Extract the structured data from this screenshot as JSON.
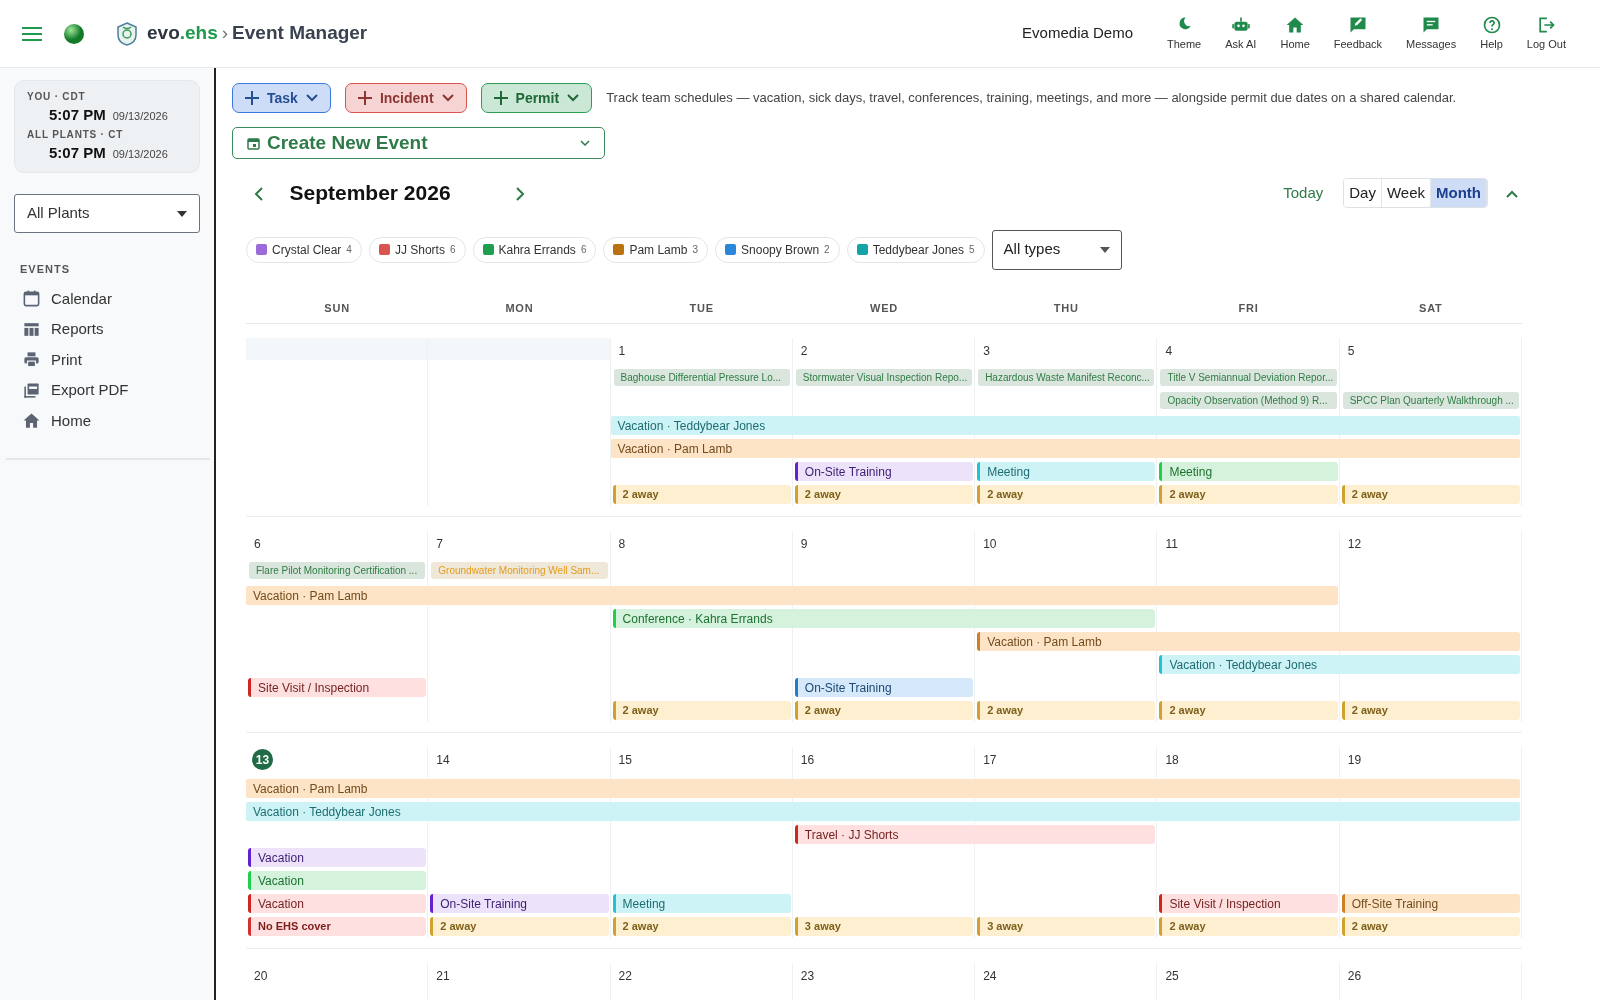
{
  "topbar": {
    "brand": {
      "name": "evo",
      "suffix": ".ehs"
    },
    "separator": "›",
    "app_title": "Event Manager",
    "account": "Evomedia Demo",
    "actions": [
      {
        "label": "Theme",
        "kind": "moon"
      },
      {
        "label": "Ask AI",
        "kind": "robot"
      },
      {
        "label": "Home",
        "kind": "house"
      },
      {
        "label": "Feedback",
        "kind": "feedback"
      },
      {
        "label": "Messages",
        "kind": "messages"
      },
      {
        "label": "Help",
        "kind": "help"
      },
      {
        "label": "Log Out",
        "kind": "logout"
      }
    ]
  },
  "sidebar": {
    "clocks": [
      {
        "label": "YOU · CDT",
        "time": "5:07 PM",
        "date": "09/13/2026"
      },
      {
        "label": "ALL PLANTS · CT",
        "time": "5:07 PM",
        "date": "09/13/2026"
      }
    ],
    "plant_select": "All Plants",
    "section": "EVENTS",
    "items": [
      {
        "label": "Calendar",
        "kind": "calendar"
      },
      {
        "label": "Reports",
        "kind": "table"
      },
      {
        "label": "Print",
        "kind": "printer"
      },
      {
        "label": "Export PDF",
        "kind": "pdf"
      },
      {
        "label": "Home",
        "kind": "house"
      }
    ]
  },
  "toolbar": {
    "buttons": [
      {
        "label": "Task",
        "color": "#3b78e0"
      },
      {
        "label": "Incident",
        "color": "#d9534f"
      },
      {
        "label": "Permit",
        "color": "#2f9e55"
      }
    ],
    "description": "Track team schedules — vacation, sick days, travel, conferences, training, meetings, and more — alongside permit due dates on a shared calendar.",
    "create_event": "Create New Event"
  },
  "calendar": {
    "month": "September 2026",
    "today_button": "Today",
    "views": [
      {
        "label": "Day",
        "selected": false
      },
      {
        "label": "Week",
        "selected": false
      },
      {
        "label": "Month",
        "selected": true
      }
    ],
    "filters": [
      {
        "name": "Crystal Clear",
        "count": "4",
        "color": "#9b6bdc"
      },
      {
        "name": "JJ Shorts",
        "count": "6",
        "color": "#d9534f"
      },
      {
        "name": "Kahra Errands",
        "count": "6",
        "color": "#1e9e4f"
      },
      {
        "name": "Pam Lamb",
        "count": "3",
        "color": "#b8720f"
      },
      {
        "name": "Snoopy Brown",
        "count": "2",
        "color": "#2a86d8"
      },
      {
        "name": "Teddybear Jones",
        "count": "5",
        "color": "#14a3a8"
      }
    ],
    "type_select": "All types",
    "weekdays": [
      "SUN",
      "MON",
      "TUE",
      "WED",
      "THU",
      "FRI",
      "SAT"
    ],
    "weeks": [
      {
        "days": [
          {
            "outside": true
          },
          {
            "outside": true
          },
          {
            "label": "1",
            "today": false
          },
          {
            "label": "2",
            "today": false
          },
          {
            "label": "3",
            "today": false
          },
          {
            "label": "4",
            "today": false
          },
          {
            "label": "5",
            "today": false
          }
        ],
        "lanes": [
          [
            {
              "kind": "empty"
            },
            {
              "kind": "empty"
            },
            {
              "kind": "permit",
              "text": "Baghouse Differential Pressure Lo...",
              "color": "#2f7d45"
            },
            {
              "kind": "permit",
              "text": "Stormwater Visual Inspection Repo...",
              "color": "#2f7d45"
            },
            {
              "kind": "permit",
              "text": "Hazardous Waste Manifest Reconc...",
              "color": "#2f7d45"
            },
            {
              "kind": "permit",
              "text": "Title V Semiannual Deviation Repor...",
              "color": "#2f7d45"
            },
            {
              "kind": "empty"
            }
          ],
          [
            {
              "kind": "empty"
            },
            {
              "kind": "empty"
            },
            {
              "kind": "empty"
            },
            {
              "kind": "empty"
            },
            {
              "kind": "empty"
            },
            {
              "kind": "permit",
              "text": "Opacity Observation (Method 9) R...",
              "color": "#2f7d45"
            },
            {
              "kind": "permit",
              "text": "SPCC Plan Quarterly Walkthrough ...",
              "color": "#2f7d45"
            }
          ],
          [
            {
              "kind": "empty"
            },
            {
              "kind": "empty"
            },
            {
              "kind": "bar",
              "text": "Vacation · Teddybear Jones",
              "color": "#cdf3f6",
              "starts": false
            },
            {
              "kind": "continued"
            },
            {
              "kind": "continued"
            },
            {
              "kind": "continued"
            },
            {
              "kind": "continued"
            }
          ],
          [
            {
              "kind": "empty"
            },
            {
              "kind": "empty"
            },
            {
              "kind": "bar",
              "text": "Vacation · Pam Lamb",
              "color": "#fde4c6",
              "starts": false
            },
            {
              "kind": "continued"
            },
            {
              "kind": "continued"
            },
            {
              "kind": "continued"
            },
            {
              "kind": "continued"
            }
          ],
          [
            {
              "kind": "empty"
            },
            {
              "kind": "empty"
            },
            {
              "kind": "empty"
            },
            {
              "kind": "bar",
              "text": "On-Site Training",
              "color": "#ece3fb",
              "starts": true
            },
            {
              "kind": "bar",
              "text": "Meeting",
              "color": "#cdf3f6",
              "starts": true
            },
            {
              "kind": "bar",
              "text": "Meeting",
              "color": "#d5f2dc",
              "starts": true
            },
            {
              "kind": "empty"
            }
          ],
          [
            {
              "kind": "empty"
            },
            {
              "kind": "empty"
            },
            {
              "kind": "away",
              "text": "2 away",
              "color": "#fdefcf"
            },
            {
              "kind": "away",
              "text": "2 away",
              "color": "#fdefcf"
            },
            {
              "kind": "away",
              "text": "2 away",
              "color": "#fdefcf"
            },
            {
              "kind": "away",
              "text": "2 away",
              "color": "#fdefcf"
            },
            {
              "kind": "away",
              "text": "2 away",
              "color": "#fdefcf"
            }
          ]
        ]
      },
      {
        "days": [
          {
            "label": "6",
            "today": false
          },
          {
            "label": "7",
            "today": false
          },
          {
            "label": "8",
            "today": false
          },
          {
            "label": "9",
            "today": false
          },
          {
            "label": "10",
            "today": false
          },
          {
            "label": "11",
            "today": false
          },
          {
            "label": "12",
            "today": false
          }
        ],
        "lanes": [
          [
            {
              "kind": "permit",
              "text": "Flare Pilot Monitoring Certification ...",
              "color": "#2f7d45"
            },
            {
              "kind": "permit",
              "text": "Groundwater Monitoring Well Sam...",
              "color": "#e39b1c"
            },
            {
              "kind": "empty"
            },
            {
              "kind": "empty"
            },
            {
              "kind": "empty"
            },
            {
              "kind": "empty"
            },
            {
              "kind": "empty"
            }
          ],
          [
            {
              "kind": "bar",
              "text": "Vacation · Pam Lamb",
              "color": "#fde4c6",
              "starts": false
            },
            {
              "kind": "continued"
            },
            {
              "kind": "continued"
            },
            {
              "kind": "continued"
            },
            {
              "kind": "continued"
            },
            {
              "kind": "continued"
            },
            {
              "kind": "empty"
            }
          ],
          [
            {
              "kind": "empty"
            },
            {
              "kind": "empty"
            },
            {
              "kind": "bar",
              "text": "Conference · Kahra Errands",
              "color": "#d5f2dc",
              "starts": true
            },
            {
              "kind": "continued"
            },
            {
              "kind": "continued"
            },
            {
              "kind": "empty"
            },
            {
              "kind": "empty"
            }
          ],
          [
            {
              "kind": "empty"
            },
            {
              "kind": "empty"
            },
            {
              "kind": "empty"
            },
            {
              "kind": "empty"
            },
            {
              "kind": "bar",
              "text": "Vacation · Pam Lamb",
              "color": "#fde4c6",
              "starts": true
            },
            {
              "kind": "continued"
            },
            {
              "kind": "continued"
            }
          ],
          [
            {
              "kind": "empty"
            },
            {
              "kind": "empty"
            },
            {
              "kind": "empty"
            },
            {
              "kind": "empty"
            },
            {
              "kind": "empty"
            },
            {
              "kind": "bar",
              "text": "Vacation · Teddybear Jones",
              "color": "#cdf3f6",
              "starts": true
            },
            {
              "kind": "continued"
            }
          ],
          [
            {
              "kind": "bar",
              "text": "Site Visit / Inspection",
              "color": "#fde0df",
              "starts": true
            },
            {
              "kind": "empty"
            },
            {
              "kind": "empty"
            },
            {
              "kind": "bar",
              "text": "On-Site Training",
              "color": "#d6e9fb",
              "starts": true
            },
            {
              "kind": "empty"
            },
            {
              "kind": "empty"
            },
            {
              "kind": "empty"
            }
          ],
          [
            {
              "kind": "empty"
            },
            {
              "kind": "empty"
            },
            {
              "kind": "away",
              "text": "2 away",
              "color": "#fdefcf"
            },
            {
              "kind": "away",
              "text": "2 away",
              "color": "#fdefcf"
            },
            {
              "kind": "away",
              "text": "2 away",
              "color": "#fdefcf"
            },
            {
              "kind": "away",
              "text": "2 away",
              "color": "#fdefcf"
            },
            {
              "kind": "away",
              "text": "2 away",
              "color": "#fdefcf"
            }
          ]
        ]
      },
      {
        "days": [
          {
            "label": "13",
            "today": true
          },
          {
            "label": "14",
            "today": false
          },
          {
            "label": "15",
            "today": false
          },
          {
            "label": "16",
            "today": false
          },
          {
            "label": "17",
            "today": false
          },
          {
            "label": "18",
            "today": false
          },
          {
            "label": "19",
            "today": false
          }
        ],
        "lanes": [
          [
            {
              "kind": "bar",
              "text": "Vacation · Pam Lamb",
              "color": "#fde4c6",
              "starts": false
            },
            {
              "kind": "continued"
            },
            {
              "kind": "continued"
            },
            {
              "kind": "continued"
            },
            {
              "kind": "continued"
            },
            {
              "kind": "continued"
            },
            {
              "kind": "continued"
            }
          ],
          [
            {
              "kind": "bar",
              "text": "Vacation · Teddybear Jones",
              "color": "#cdf3f6",
              "starts": false
            },
            {
              "kind": "continued"
            },
            {
              "kind": "continued"
            },
            {
              "kind": "continued"
            },
            {
              "kind": "continued"
            },
            {
              "kind": "continued"
            },
            {
              "kind": "continued"
            }
          ],
          [
            {
              "kind": "empty"
            },
            {
              "kind": "empty"
            },
            {
              "kind": "empty"
            },
            {
              "kind": "bar",
              "text": "Travel · JJ Shorts",
              "color": "#fde0df",
              "starts": true
            },
            {
              "kind": "continued"
            },
            {
              "kind": "empty"
            },
            {
              "kind": "empty"
            }
          ],
          [
            {
              "kind": "bar",
              "text": "Vacation",
              "color": "#ece3fb",
              "starts": true
            },
            {
              "kind": "empty"
            },
            {
              "kind": "empty"
            },
            {
              "kind": "empty"
            },
            {
              "kind": "empty"
            },
            {
              "kind": "empty"
            },
            {
              "kind": "empty"
            }
          ],
          [
            {
              "kind": "bar",
              "text": "Vacation",
              "color": "#d5f2dc",
              "starts": true
            },
            {
              "kind": "empty"
            },
            {
              "kind": "empty"
            },
            {
              "kind": "empty"
            },
            {
              "kind": "empty"
            },
            {
              "kind": "empty"
            },
            {
              "kind": "empty"
            }
          ],
          [
            {
              "kind": "bar",
              "text": "Vacation",
              "color": "#fde0df",
              "starts": true
            },
            {
              "kind": "bar",
              "text": "On-Site Training",
              "color": "#ece3fb",
              "starts": true
            },
            {
              "kind": "bar",
              "text": "Meeting",
              "color": "#cdf3f6",
              "starts": true
            },
            {
              "kind": "empty"
            },
            {
              "kind": "empty"
            },
            {
              "kind": "bar",
              "text": "Site Visit / Inspection",
              "color": "#fde0df",
              "starts": true
            },
            {
              "kind": "bar",
              "text": "Off-Site Training",
              "color": "#fde4c6",
              "starts": true
            }
          ],
          [
            {
              "kind": "away",
              "text": "No EHS cover",
              "color": "#fde0df"
            },
            {
              "kind": "away",
              "text": "2 away",
              "color": "#fdefcf"
            },
            {
              "kind": "away",
              "text": "2 away",
              "color": "#fdefcf"
            },
            {
              "kind": "away",
              "text": "3 away",
              "color": "#fdefcf"
            },
            {
              "kind": "away",
              "text": "3 away",
              "color": "#fdefcf"
            },
            {
              "kind": "away",
              "text": "2 away",
              "color": "#fdefcf"
            },
            {
              "kind": "away",
              "text": "2 away",
              "color": "#fdefcf"
            }
          ]
        ]
      },
      {
        "days": [
          {
            "label": "20",
            "today": false
          },
          {
            "label": "21",
            "today": false
          },
          {
            "label": "22",
            "today": false
          },
          {
            "label": "23",
            "today": false
          },
          {
            "label": "24",
            "today": false
          },
          {
            "label": "25",
            "today": false
          },
          {
            "label": "26",
            "today": false
          }
        ]
      }
    ]
  }
}
